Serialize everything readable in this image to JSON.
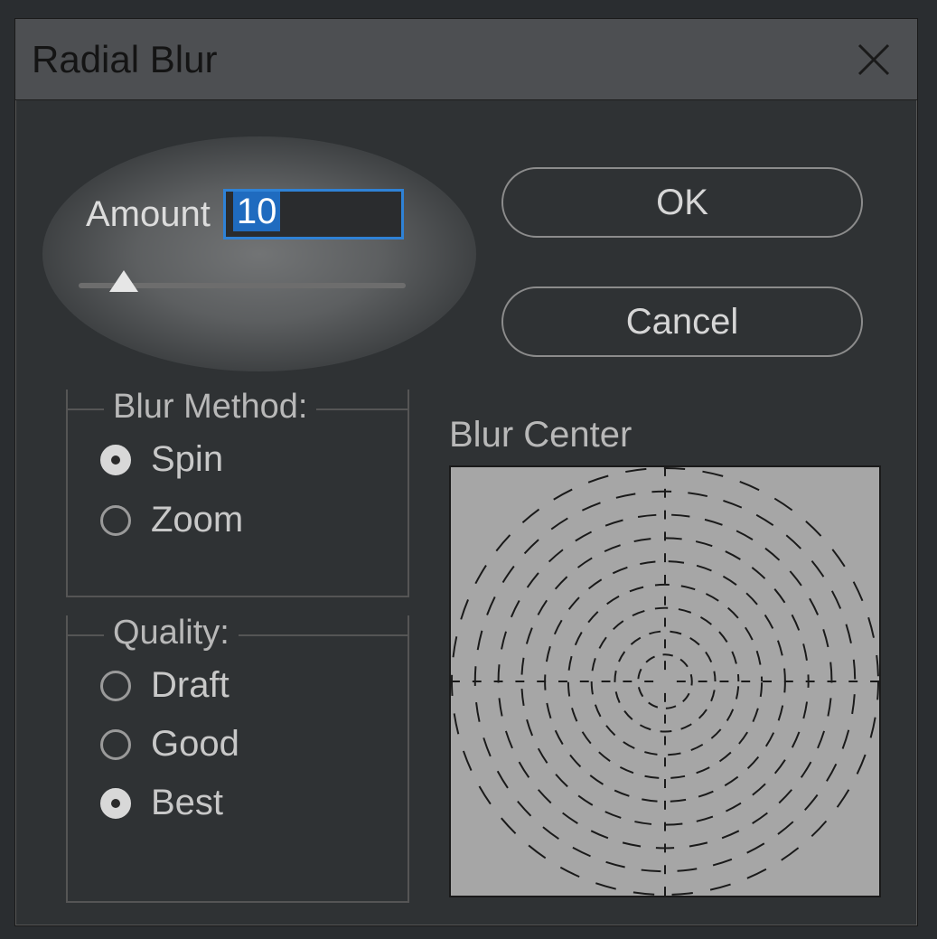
{
  "dialog": {
    "title": "Radial Blur",
    "amount_label": "Amount",
    "amount_value": "10",
    "slider_percent": 10,
    "buttons": {
      "ok": "OK",
      "cancel": "Cancel"
    },
    "blur_method": {
      "legend": "Blur Method:",
      "options": [
        {
          "label": "Spin",
          "checked": true
        },
        {
          "label": "Zoom",
          "checked": false
        }
      ]
    },
    "quality": {
      "legend": "Quality:",
      "options": [
        {
          "label": "Draft",
          "checked": false
        },
        {
          "label": "Good",
          "checked": false
        },
        {
          "label": "Best",
          "checked": true
        }
      ]
    },
    "blur_center_label": "Blur Center"
  }
}
